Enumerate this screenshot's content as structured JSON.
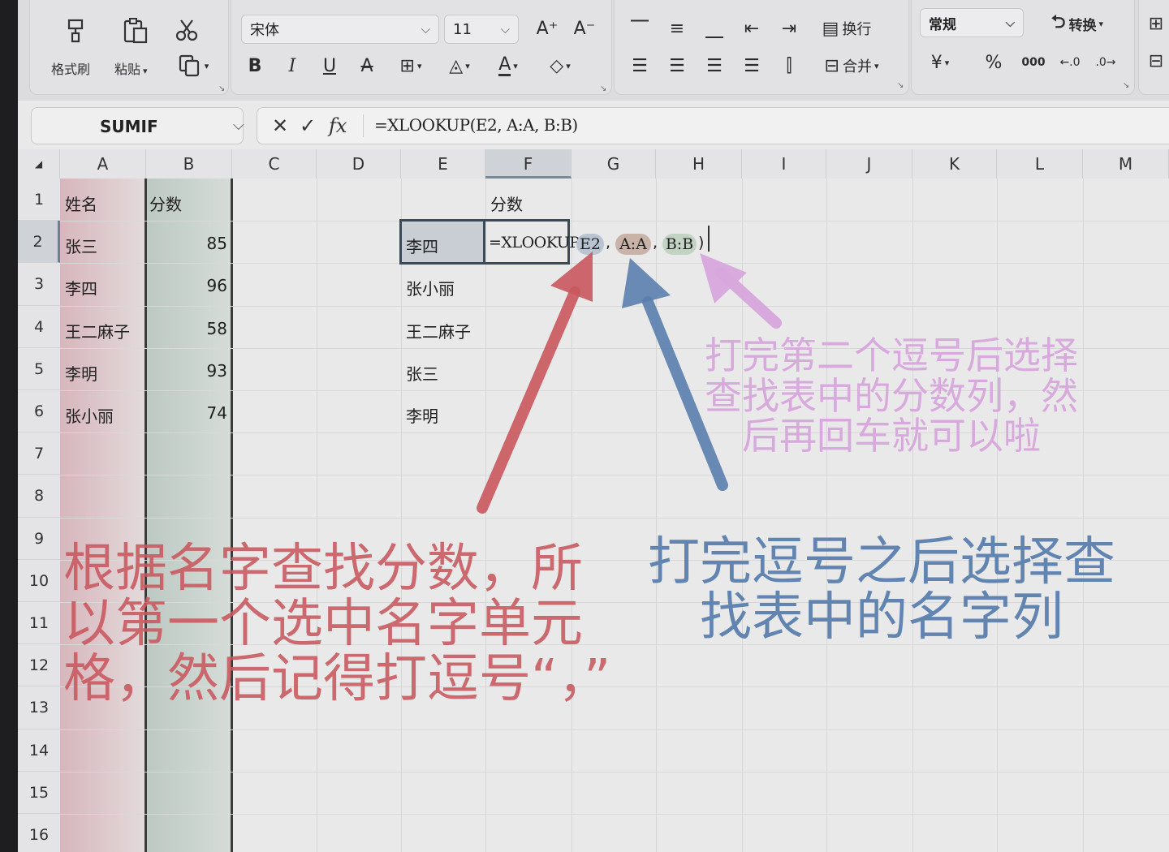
{
  "ribbon": {
    "format_painter": "格式刷",
    "paste": "粘贴",
    "font_name": "宋体",
    "font_size": "11",
    "wrap_text": "换行",
    "merge": "合并",
    "number_format": "常规",
    "convert": "转换",
    "currency": "¥",
    "percent": "%",
    "thousands": "000"
  },
  "namebox": {
    "value": "SUMIF"
  },
  "formula_bar": {
    "cancel": "✕",
    "confirm": "✓",
    "fx": "fx",
    "formula": "=XLOOKUP(E2, A:A, B:B)"
  },
  "columns": [
    "A",
    "B",
    "C",
    "D",
    "E",
    "F",
    "G",
    "H",
    "I",
    "J",
    "K",
    "L",
    "M"
  ],
  "rows": [
    "1",
    "2",
    "3",
    "4",
    "5",
    "6",
    "7",
    "8",
    "9",
    "10",
    "11",
    "12",
    "13",
    "14",
    "15",
    "16"
  ],
  "cells": {
    "A1": "姓名",
    "B1": "分数",
    "A2": "张三",
    "B2": "85",
    "A3": "李四",
    "B3": "96",
    "A4": "王二麻子",
    "B4": "58",
    "A5": "李明",
    "B5": "93",
    "A6": "张小丽",
    "B6": "74",
    "F1": "分数",
    "E2": "李四",
    "E3": "张小丽",
    "E4": "王二麻子",
    "E5": "张三",
    "E6": "李明",
    "F2_prefix": "=XLOOKUP(",
    "F2_ref1": "E2",
    "F2_sep1": ",",
    "F2_ref2": "A:A",
    "F2_sep2": ",",
    "F2_ref3": "B:B",
    "F2_suffix": ")"
  },
  "annotations": {
    "red": "根据名字查找分数，所\n以第一个选中名字单元\n格，然后记得打逗号“，”",
    "blue": "打完逗号之后选择查\n找表中的名字列",
    "pink": "打完第二个逗号后选择\n查找表中的分数列，然\n后再回车就可以啦"
  },
  "colors": {
    "annotation_red": "#c9585e",
    "annotation_blue": "#5a7fae",
    "annotation_pink": "#d8a6dc",
    "ref1_highlight": "#b8c4d2",
    "ref2_highlight": "#c9b3a8",
    "ref3_highlight": "#c2d3c4"
  }
}
